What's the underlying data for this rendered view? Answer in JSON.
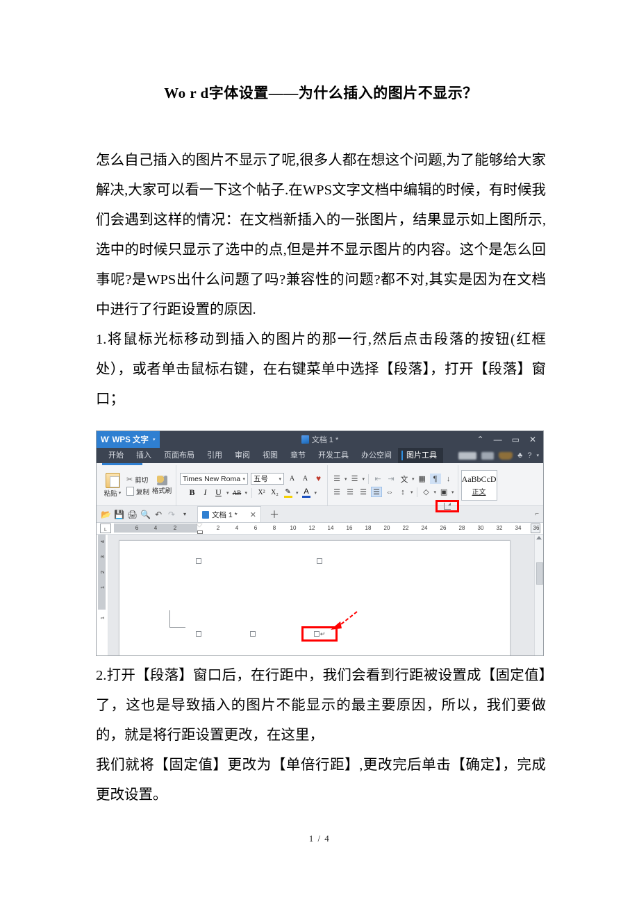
{
  "document": {
    "title": "Wo r d字体设置——为什么插入的图片不显示？",
    "paragraphs": [
      "怎么自己插入的图片不显示了呢,很多人都在想这个问题,为了能够给大家解决,大家可以看一下这个帖子.在WPS文字文档中编辑的时候，有时候我们会遇到这样的情况：在文档新插入的一张图片，结果显示如上图所示,选中的时候只显示了选中的点,但是并不显示图片的内容。这个是怎么回事呢?是WPS出什么问题了吗?兼容性的问题?都不对,其实是因为在文档中进行了行距设置的原因.",
      "1.将鼠标光标移动到插入的图片的那一行,然后点击段落的按钮(红框处），或者单击鼠标右键，在右键菜单中选择【段落】，打开【段落】窗口；"
    ],
    "paragraphs_after": [
      "2.打开【段落】窗口后，在行距中，我们会看到行距被设置成【固定值】了，这也是导致插入的图片不能显示的最主要原因，所以，我们要做的，就是将行距设置更改，在这里，",
      "我们就将【固定值】更改为【单倍行距】,更改完后单击【确定】，完成更改设置。"
    ],
    "footer": "1 / 4"
  },
  "wps": {
    "titlebar": {
      "app_name": "WPS 文字",
      "app_caret": "▾",
      "doc_title": "文档 1 *",
      "controls": {
        "collapse": "⌃",
        "minimize": "—",
        "maximize": "▭",
        "close": "✕"
      }
    },
    "tabs": [
      {
        "label": "开始",
        "active": false
      },
      {
        "label": "插入",
        "active": false
      },
      {
        "label": "页面布局",
        "active": false
      },
      {
        "label": "引用",
        "active": false
      },
      {
        "label": "审阅",
        "active": false
      },
      {
        "label": "视图",
        "active": false
      },
      {
        "label": "章节",
        "active": false
      },
      {
        "label": "开发工具",
        "active": false
      },
      {
        "label": "办公空间",
        "active": false
      },
      {
        "label": "图片工具",
        "active": true
      }
    ],
    "tabbar_right": {
      "shirt_icon": "♣",
      "help": "?",
      "help_caret": "▾"
    },
    "ribbon": {
      "clipboard": {
        "paste": "粘贴",
        "paste_caret": "▾",
        "cut": "剪切",
        "copy": "复制",
        "format_painter": "格式刷"
      },
      "font": {
        "font_name": "Times New Roma",
        "font_size": "五号",
        "caret": "▾",
        "grow_font": "A",
        "shrink_font": "A",
        "clear_format": "♥",
        "bold": "B",
        "italic": "I",
        "underline": "U",
        "strikethrough": "AB",
        "superscript": "X²",
        "subscript": "X₂",
        "highlight": "✎",
        "font_color": "A",
        "pinyin": "文"
      },
      "paragraph": {
        "bullets": "☰",
        "numbering": "☰",
        "decrease_indent": "⇤",
        "increase_indent": "⇥",
        "asian_layout": "文",
        "borders": "▦",
        "sort": "↓",
        "show_marks": "¶",
        "align_left": "☰",
        "align_center": "☰",
        "align_right": "☰",
        "align_justify": "☰",
        "distribute": "⇔",
        "line_spacing": "↕",
        "shading": "◇",
        "border": "▣",
        "dialog_launcher": "⌐"
      },
      "styles": {
        "sample": "AaBbCcD",
        "name": "正文"
      }
    },
    "quick_access": {
      "open": "📂",
      "save": "💾",
      "print": "🖨",
      "preview": "🔍",
      "undo": "↶",
      "redo": "↷",
      "more_caret": "▾",
      "doc_tab_label": "文档 1 *",
      "doc_tab_close": "✕",
      "new_tab": "＋",
      "right_corner": "⌐"
    },
    "ruler": {
      "corner_label": "L",
      "left_margin_numbers": [
        "6",
        "4",
        "2"
      ],
      "numbers": [
        "2",
        "4",
        "6",
        "8",
        "10",
        "12",
        "14",
        "16",
        "18",
        "20",
        "22",
        "24",
        "26",
        "28",
        "30",
        "32",
        "34",
        "36"
      ],
      "vertical_numbers": [
        "4",
        "3",
        "2",
        "1",
        "1"
      ]
    },
    "canvas": {
      "selection_handles": 5,
      "annotation_color": "#ff0000",
      "paragraph_mark": "↵"
    },
    "colors": {
      "titlebar": "#3c4452",
      "logo_blue": "#2f7fd1",
      "accent_blue": "#2f8fe0",
      "ribbon_bg": "#f3f4f6",
      "annotation_red": "#ff0000"
    }
  }
}
